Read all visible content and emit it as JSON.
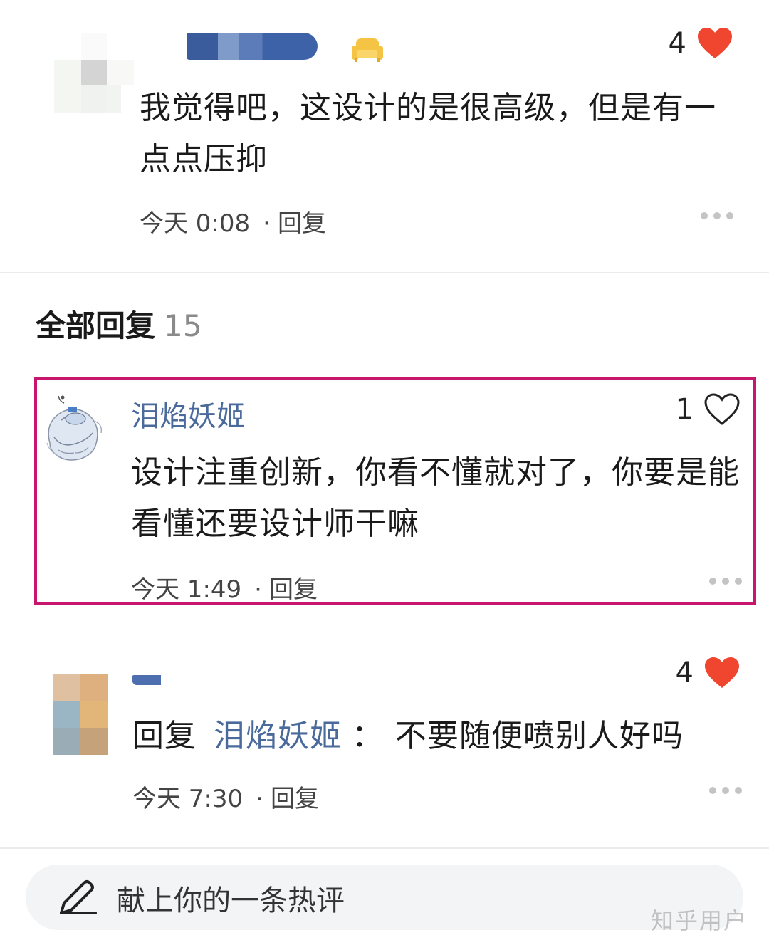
{
  "comments": [
    {
      "text": "我觉得吧，这设计的是很高级，但是有一点点压抑",
      "time": "今天 0:08",
      "reply_label": "回复",
      "likes": "4",
      "liked": true
    },
    {
      "name": "泪焰妖姬",
      "text": "设计注重创新，你看不懂就对了，你要是能看懂还要设计师干嘛",
      "time": "今天 1:49",
      "reply_label": "回复",
      "likes": "1",
      "liked": false
    },
    {
      "reply_prefix": "回复",
      "reply_target": "泪焰妖姬",
      "colon": "：",
      "text": "不要随便喷别人好吗",
      "time": "今天 7:30",
      "reply_label": "回复",
      "likes": "4",
      "liked": true
    }
  ],
  "all_replies": {
    "label": "全部回复",
    "count": "15"
  },
  "input": {
    "placeholder": "献上你的一条热评"
  },
  "watermark": "知乎用户",
  "colors": {
    "like_red": "#f0452f",
    "name_blue": "#4a6a9c",
    "highlight": "#c8166f"
  }
}
